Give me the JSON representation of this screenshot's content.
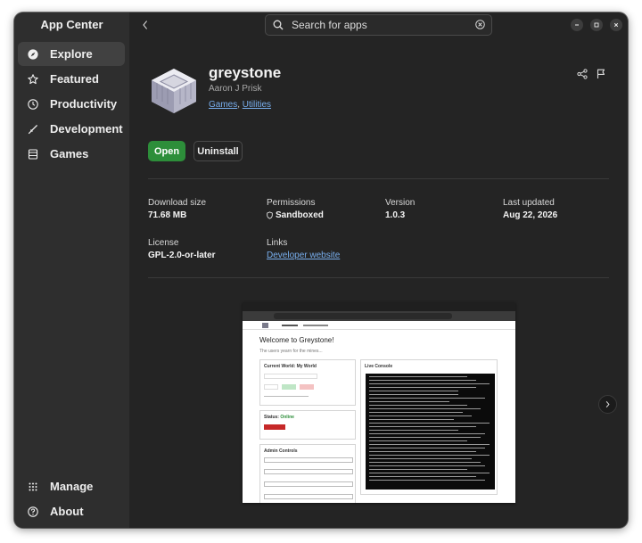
{
  "sidebar": {
    "title": "App Center",
    "items": [
      {
        "label": "Explore"
      },
      {
        "label": "Featured"
      },
      {
        "label": "Productivity"
      },
      {
        "label": "Development"
      },
      {
        "label": "Games"
      }
    ],
    "bottom_items": [
      {
        "label": "Manage"
      },
      {
        "label": "About"
      }
    ]
  },
  "header": {
    "search_placeholder": "Search for apps"
  },
  "app": {
    "name": "greystone",
    "developer": "Aaron J Prisk",
    "categories": [
      "Games",
      "Utilities"
    ],
    "category_separator": ", ",
    "open_label": "Open",
    "uninstall_label": "Uninstall"
  },
  "details": {
    "download_size": {
      "label": "Download size",
      "value": "71.68 MB"
    },
    "permissions": {
      "label": "Permissions",
      "value": "Sandboxed"
    },
    "version": {
      "label": "Version",
      "value": "1.0.3"
    },
    "last_updated": {
      "label": "Last updated",
      "value": "Aug 22, 2026"
    },
    "license": {
      "label": "License",
      "value": "GPL-2.0-or-later"
    },
    "links": {
      "label": "Links",
      "value": "Developer website"
    }
  },
  "screenshot_preview": {
    "heading": "Welcome to Greystone!",
    "subheading": "The users yearn for the mines...",
    "world_panel": "Current World: My World",
    "console_panel": "Live Console",
    "status_label": "Status:",
    "status_value": "Online",
    "admin_panel": "Admin Controls"
  },
  "carousel": {
    "active_index": 0,
    "count": 2
  },
  "colors": {
    "accent": "#e95420",
    "open_button": "#2d8e3a",
    "link": "#78aeed",
    "sidebar_bg": "#2e2e2e",
    "window_bg": "#242424"
  }
}
